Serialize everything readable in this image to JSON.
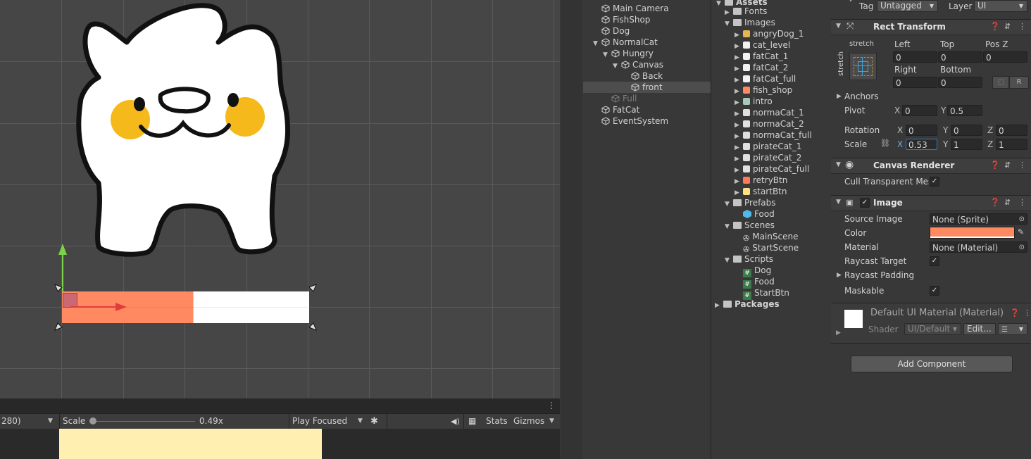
{
  "scene": {
    "bar_fill_fraction": 0.53
  },
  "game_toolbar": {
    "resolution_fragment": "280)",
    "scale_label": "Scale",
    "scale_value": "0.49x",
    "play_mode": "Play Focused",
    "stats": "Stats",
    "gizmos": "Gizmos"
  },
  "hierarchy": {
    "items": [
      {
        "label": "Main Camera"
      },
      {
        "label": "FishShop"
      },
      {
        "label": "Dog"
      },
      {
        "label": "NormalCat"
      },
      {
        "label": "Hungry"
      },
      {
        "label": "Canvas"
      },
      {
        "label": "Back"
      },
      {
        "label": "front"
      },
      {
        "label": "Full"
      },
      {
        "label": "FatCat"
      },
      {
        "label": "EventSystem"
      }
    ]
  },
  "project": {
    "root": "Assets",
    "items": [
      {
        "label": "Fonts"
      },
      {
        "label": "Images"
      },
      {
        "label": "angryDog_1"
      },
      {
        "label": "cat_level"
      },
      {
        "label": "fatCat_1"
      },
      {
        "label": "fatCat_2"
      },
      {
        "label": "fatCat_full"
      },
      {
        "label": "fish_shop"
      },
      {
        "label": "intro"
      },
      {
        "label": "normaCat_1"
      },
      {
        "label": "normaCat_2"
      },
      {
        "label": "normaCat_full"
      },
      {
        "label": "pirateCat_1"
      },
      {
        "label": "pirateCat_2"
      },
      {
        "label": "pirateCat_full"
      },
      {
        "label": "retryBtn"
      },
      {
        "label": "startBtn"
      },
      {
        "label": "Prefabs"
      },
      {
        "label": "Food"
      },
      {
        "label": "Scenes"
      },
      {
        "label": "MainScene"
      },
      {
        "label": "StartScene"
      },
      {
        "label": "Scripts"
      },
      {
        "label": "Dog"
      },
      {
        "label": "Food"
      },
      {
        "label": "StartBtn"
      },
      {
        "label": "Packages"
      }
    ]
  },
  "inspector": {
    "tag_label": "Tag",
    "tag_value": "Untagged",
    "layer_label": "Layer",
    "layer_value": "UI",
    "rect_transform": {
      "title": "Rect Transform",
      "stretch_h": "stretch",
      "stretch_v": "stretch",
      "left_label": "Left",
      "left": "0",
      "top_label": "Top",
      "top": "0",
      "posz_label": "Pos Z",
      "posz": "0",
      "right_label": "Right",
      "right": "0",
      "bottom_label": "Bottom",
      "bottom": "0",
      "r_button": "R",
      "anchors_label": "Anchors",
      "pivot_label": "Pivot",
      "pivot_x": "0",
      "pivot_y": "0.5",
      "rotation_label": "Rotation",
      "rot_x": "0",
      "rot_y": "0",
      "rot_z": "0",
      "scale_label": "Scale",
      "scale_x": "0.53",
      "scale_y": "1",
      "scale_z": "1",
      "axis_x": "X",
      "axis_y": "Y",
      "axis_z": "Z"
    },
    "canvas_renderer": {
      "title": "Canvas Renderer",
      "cull_label": "Cull Transparent Mes"
    },
    "image": {
      "title": "Image",
      "source_label": "Source Image",
      "source_value": "None (Sprite)",
      "color_label": "Color",
      "color_hex": "#ff8a62",
      "material_label": "Material",
      "material_value": "None (Material)",
      "raycast_target_label": "Raycast Target",
      "raycast_padding_label": "Raycast Padding",
      "maskable_label": "Maskable"
    },
    "material_block": {
      "title": "Default UI Material (Material)",
      "shader_label": "Shader",
      "shader_value": "UI/Default",
      "edit_button": "Edit..."
    },
    "add_component": "Add Component"
  }
}
